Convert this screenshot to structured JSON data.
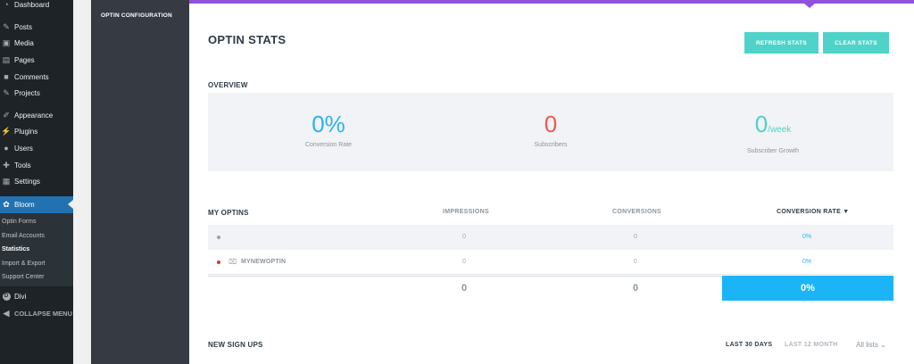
{
  "wp_menu": [
    {
      "label": "Dashboard",
      "icon": "dashboard-icon",
      "glyph": "◔"
    },
    {
      "label": "Posts",
      "icon": "pin-icon",
      "glyph": "✎"
    },
    {
      "label": "Media",
      "icon": "media-icon",
      "glyph": "▣"
    },
    {
      "label": "Pages",
      "icon": "pages-icon",
      "glyph": "▤"
    },
    {
      "label": "Comments",
      "icon": "comment-icon",
      "glyph": "■"
    },
    {
      "label": "Projects",
      "icon": "pin-icon",
      "glyph": "✎"
    },
    {
      "label": "Appearance",
      "icon": "brush-icon",
      "glyph": "✐"
    },
    {
      "label": "Plugins",
      "icon": "plug-icon",
      "glyph": "⚡"
    },
    {
      "label": "Users",
      "icon": "user-icon",
      "glyph": "●"
    },
    {
      "label": "Tools",
      "icon": "wrench-icon",
      "glyph": "✚"
    },
    {
      "label": "Settings",
      "icon": "settings-icon",
      "glyph": "▦"
    },
    {
      "label": "Bloom",
      "icon": "bloom-icon",
      "glyph": "✿"
    }
  ],
  "wp_submenu": [
    "Optin Forms",
    "Email Accounts",
    "Statistics",
    "Import & Export",
    "Support Center"
  ],
  "wp_menu_bottom": {
    "divi": "Divi",
    "divi_glyph": "D",
    "collapse": "COLLAPSE MENU",
    "collapse_glyph": "◀"
  },
  "bloom_nav": {
    "item": "OPTIN CONFIGURATION"
  },
  "page": {
    "title": "OPTIN STATS",
    "refresh_label": "REFRESH STATS",
    "clear_label": "CLEAR STATS"
  },
  "overview": {
    "label": "OVERVIEW",
    "conversion_rate": {
      "value": "0%",
      "label": "Conversion Rate"
    },
    "subscribers": {
      "value": "0",
      "label": "Subscribers"
    },
    "growth": {
      "value": "0",
      "unit": "/week",
      "label": "Subscriber Growth"
    }
  },
  "optins": {
    "label": "MY OPTINS",
    "columns": {
      "impressions": "IMPRESSIONS",
      "conversions": "CONVERSIONS",
      "conversion_rate": "CONVERSION RATE ▼"
    },
    "rows": [
      {
        "name": "",
        "impressions": "0",
        "conversions": "0",
        "rate": "0%"
      },
      {
        "name": "MYNEWOPTIN",
        "icon_glyph": "⌧",
        "impressions": "0",
        "conversions": "0",
        "rate": "0%"
      }
    ],
    "totals": {
      "impressions": "0",
      "conversions": "0",
      "rate": "0%"
    }
  },
  "signups": {
    "label": "NEW SIGN UPS",
    "range_30": "LAST 30 DAYS",
    "range_12m": "LAST 12 MONTH",
    "list_select": "All lists",
    "list_select_glyph": "⌄"
  },
  "colors": {
    "accent_purple": "#9250de",
    "button_teal": "#4fd3c8",
    "conversion_blue": "#2ab3f2",
    "subscribers_red": "#ef5a49",
    "growth_teal": "#4fd3c8",
    "total_blue": "#1bb4f7",
    "dot_gray": "#9aa0a6",
    "dot_red": "#e0342a"
  }
}
